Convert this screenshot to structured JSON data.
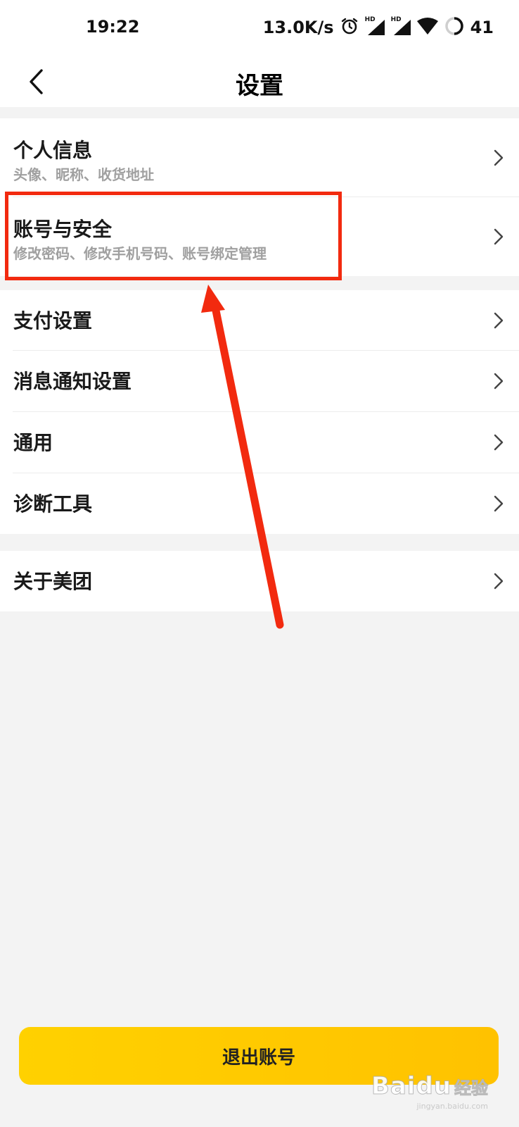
{
  "status_bar": {
    "time": "19:22",
    "net_speed": "13.0K/s",
    "signal_label": "HD",
    "battery": "41",
    "icons": [
      "alarm-icon",
      "signal-hd-icon",
      "signal-hd-icon",
      "wifi-icon",
      "battery-ring-icon"
    ]
  },
  "header": {
    "back_icon": "back-chevron-icon",
    "title": "设置"
  },
  "settings": {
    "group1": [
      {
        "title": "个人信息",
        "subtitle": "头像、昵称、收货地址"
      },
      {
        "title": "账号与安全",
        "subtitle": "修改密码、修改手机号码、账号绑定管理"
      }
    ],
    "group2": [
      {
        "title": "支付设置"
      },
      {
        "title": "消息通知设置"
      },
      {
        "title": "通用"
      },
      {
        "title": "诊断工具"
      }
    ],
    "group3": [
      {
        "title": "关于美团"
      }
    ]
  },
  "logout": {
    "label": "退出账号"
  },
  "watermark": {
    "logo": "Baidu",
    "cn": "经验",
    "url": "jingyan.baidu.com"
  },
  "colors": {
    "accent": "#ffc800",
    "highlight": "#f22a0f",
    "background": "#f3f3f3",
    "subtitle": "#a0a0a0"
  }
}
